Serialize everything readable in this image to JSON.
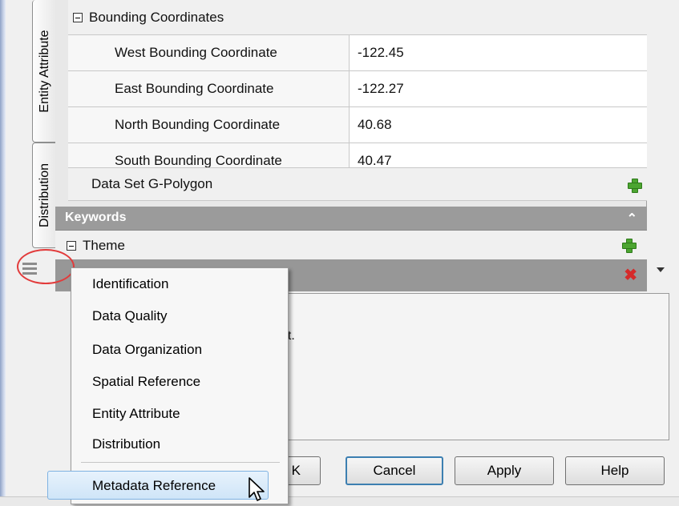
{
  "tabs": [
    {
      "label": "Entity Attribute"
    },
    {
      "label": "Distribution"
    }
  ],
  "bounding": {
    "section_label": "Bounding Coordinates",
    "rows": [
      {
        "label": "West Bounding Coordinate",
        "value": "-122.45"
      },
      {
        "label": "East Bounding Coordinate",
        "value": "-122.27"
      },
      {
        "label": "North Bounding Coordinate",
        "value": "40.68"
      },
      {
        "label": "South Bounding Coordinate",
        "value": "40.47"
      }
    ],
    "polygon_label": "Data Set G-Polygon"
  },
  "keywords": {
    "header": "Keywords",
    "theme_label": "Theme"
  },
  "description": {
    "visible_text": "et."
  },
  "buttons": {
    "ok_fragment": "K",
    "cancel": "Cancel",
    "apply": "Apply",
    "help": "Help"
  },
  "menu": {
    "items": [
      "Identification",
      "Data Quality",
      "Data Organization",
      "Spatial Reference",
      "Entity Attribute",
      "Distribution",
      "Metadata Reference"
    ],
    "highlighted": "Metadata Reference"
  },
  "icons": {
    "add": "plus-icon",
    "delete": "delete-icon",
    "collapse": "double-chevron-up-icon",
    "overflow": "menu-overflow-icon",
    "cursor": "mouse-pointer-icon"
  },
  "colors": {
    "add_green": "#4ca531",
    "delete_red": "#d52a2a",
    "highlight_circle": "#e23b3b",
    "selected_row": "#979797"
  }
}
